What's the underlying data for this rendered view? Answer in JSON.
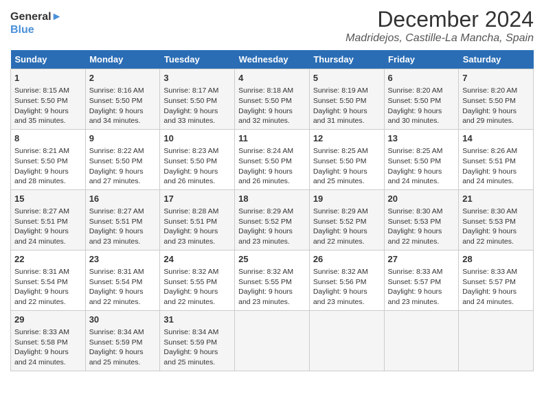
{
  "logo": {
    "line1": "General",
    "line2": "Blue"
  },
  "title": "December 2024",
  "subtitle": "Madridejos, Castille-La Mancha, Spain",
  "days_of_week": [
    "Sunday",
    "Monday",
    "Tuesday",
    "Wednesday",
    "Thursday",
    "Friday",
    "Saturday"
  ],
  "weeks": [
    [
      {
        "day": 1,
        "sunrise": "8:15 AM",
        "sunset": "5:50 PM",
        "daylight": "9 hours and 35 minutes."
      },
      {
        "day": 2,
        "sunrise": "8:16 AM",
        "sunset": "5:50 PM",
        "daylight": "9 hours and 34 minutes."
      },
      {
        "day": 3,
        "sunrise": "8:17 AM",
        "sunset": "5:50 PM",
        "daylight": "9 hours and 33 minutes."
      },
      {
        "day": 4,
        "sunrise": "8:18 AM",
        "sunset": "5:50 PM",
        "daylight": "9 hours and 32 minutes."
      },
      {
        "day": 5,
        "sunrise": "8:19 AM",
        "sunset": "5:50 PM",
        "daylight": "9 hours and 31 minutes."
      },
      {
        "day": 6,
        "sunrise": "8:20 AM",
        "sunset": "5:50 PM",
        "daylight": "9 hours and 30 minutes."
      },
      {
        "day": 7,
        "sunrise": "8:20 AM",
        "sunset": "5:50 PM",
        "daylight": "9 hours and 29 minutes."
      }
    ],
    [
      {
        "day": 8,
        "sunrise": "8:21 AM",
        "sunset": "5:50 PM",
        "daylight": "9 hours and 28 minutes."
      },
      {
        "day": 9,
        "sunrise": "8:22 AM",
        "sunset": "5:50 PM",
        "daylight": "9 hours and 27 minutes."
      },
      {
        "day": 10,
        "sunrise": "8:23 AM",
        "sunset": "5:50 PM",
        "daylight": "9 hours and 26 minutes."
      },
      {
        "day": 11,
        "sunrise": "8:24 AM",
        "sunset": "5:50 PM",
        "daylight": "9 hours and 26 minutes."
      },
      {
        "day": 12,
        "sunrise": "8:25 AM",
        "sunset": "5:50 PM",
        "daylight": "9 hours and 25 minutes."
      },
      {
        "day": 13,
        "sunrise": "8:25 AM",
        "sunset": "5:50 PM",
        "daylight": "9 hours and 24 minutes."
      },
      {
        "day": 14,
        "sunrise": "8:26 AM",
        "sunset": "5:51 PM",
        "daylight": "9 hours and 24 minutes."
      }
    ],
    [
      {
        "day": 15,
        "sunrise": "8:27 AM",
        "sunset": "5:51 PM",
        "daylight": "9 hours and 24 minutes."
      },
      {
        "day": 16,
        "sunrise": "8:27 AM",
        "sunset": "5:51 PM",
        "daylight": "9 hours and 23 minutes."
      },
      {
        "day": 17,
        "sunrise": "8:28 AM",
        "sunset": "5:51 PM",
        "daylight": "9 hours and 23 minutes."
      },
      {
        "day": 18,
        "sunrise": "8:29 AM",
        "sunset": "5:52 PM",
        "daylight": "9 hours and 23 minutes."
      },
      {
        "day": 19,
        "sunrise": "8:29 AM",
        "sunset": "5:52 PM",
        "daylight": "9 hours and 22 minutes."
      },
      {
        "day": 20,
        "sunrise": "8:30 AM",
        "sunset": "5:53 PM",
        "daylight": "9 hours and 22 minutes."
      },
      {
        "day": 21,
        "sunrise": "8:30 AM",
        "sunset": "5:53 PM",
        "daylight": "9 hours and 22 minutes."
      }
    ],
    [
      {
        "day": 22,
        "sunrise": "8:31 AM",
        "sunset": "5:54 PM",
        "daylight": "9 hours and 22 minutes."
      },
      {
        "day": 23,
        "sunrise": "8:31 AM",
        "sunset": "5:54 PM",
        "daylight": "9 hours and 22 minutes."
      },
      {
        "day": 24,
        "sunrise": "8:32 AM",
        "sunset": "5:55 PM",
        "daylight": "9 hours and 22 minutes."
      },
      {
        "day": 25,
        "sunrise": "8:32 AM",
        "sunset": "5:55 PM",
        "daylight": "9 hours and 23 minutes."
      },
      {
        "day": 26,
        "sunrise": "8:32 AM",
        "sunset": "5:56 PM",
        "daylight": "9 hours and 23 minutes."
      },
      {
        "day": 27,
        "sunrise": "8:33 AM",
        "sunset": "5:57 PM",
        "daylight": "9 hours and 23 minutes."
      },
      {
        "day": 28,
        "sunrise": "8:33 AM",
        "sunset": "5:57 PM",
        "daylight": "9 hours and 24 minutes."
      }
    ],
    [
      {
        "day": 29,
        "sunrise": "8:33 AM",
        "sunset": "5:58 PM",
        "daylight": "9 hours and 24 minutes."
      },
      {
        "day": 30,
        "sunrise": "8:34 AM",
        "sunset": "5:59 PM",
        "daylight": "9 hours and 25 minutes."
      },
      {
        "day": 31,
        "sunrise": "8:34 AM",
        "sunset": "5:59 PM",
        "daylight": "9 hours and 25 minutes."
      },
      null,
      null,
      null,
      null
    ]
  ]
}
